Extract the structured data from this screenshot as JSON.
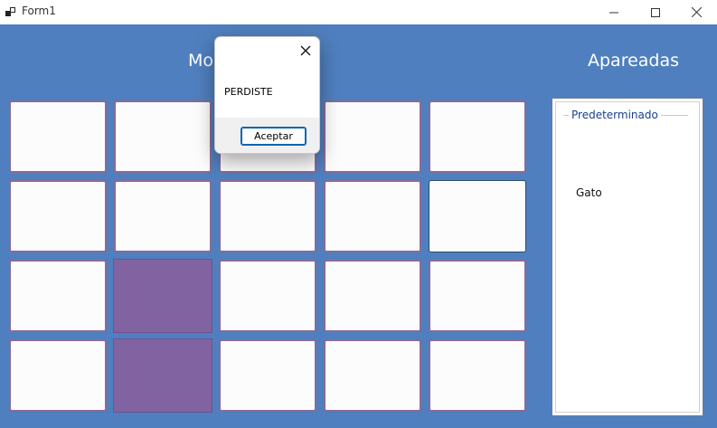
{
  "window": {
    "title": "Form1"
  },
  "headings": {
    "left": "Mo",
    "right": "Apareadas"
  },
  "board": {
    "cards": [
      {
        "state": "face-down"
      },
      {
        "state": "face-down"
      },
      {
        "state": "face-down"
      },
      {
        "state": "face-down"
      },
      {
        "state": "face-down"
      },
      {
        "state": "face-down"
      },
      {
        "state": "face-down"
      },
      {
        "state": "face-down"
      },
      {
        "state": "face-down"
      },
      {
        "state": "focused"
      },
      {
        "state": "face-down"
      },
      {
        "state": "matched"
      },
      {
        "state": "face-down"
      },
      {
        "state": "face-down"
      },
      {
        "state": "face-down"
      },
      {
        "state": "face-down"
      },
      {
        "state": "matched"
      },
      {
        "state": "face-down"
      },
      {
        "state": "face-down"
      },
      {
        "state": "face-down"
      }
    ]
  },
  "matched_panel": {
    "group_title": "Predeterminado",
    "items": [
      "Gato"
    ]
  },
  "dialog": {
    "message": "PERDISTE",
    "ok_label": "Aceptar"
  },
  "colors": {
    "background": "#4f7fbe",
    "matched_card": "#8063a0",
    "card": "#fcfcfc"
  }
}
